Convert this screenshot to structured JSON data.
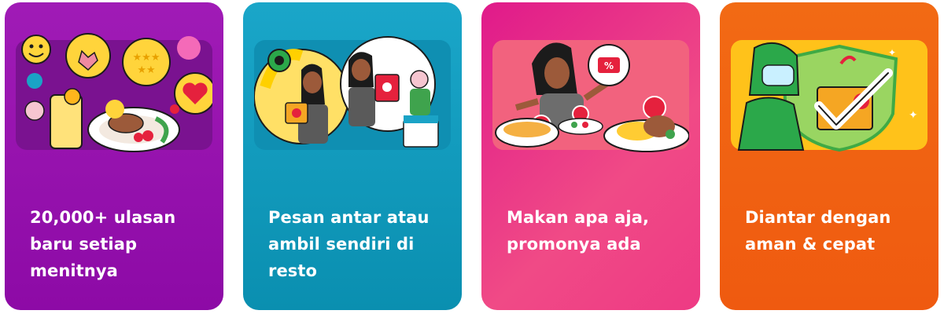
{
  "cards": [
    {
      "caption": "20,000+ ulasan\nbaru setiap\nmenitnya",
      "illustration": "reviews-illustration"
    },
    {
      "caption": "Pesan antar atau\nambil sendiri di\nresto",
      "illustration": "pickup-delivery-illustration"
    },
    {
      "caption": "Makan apa aja,\npromonya ada",
      "illustration": "promo-food-illustration"
    },
    {
      "caption": "Diantar dengan\naman & cepat",
      "illustration": "safe-delivery-illustration"
    }
  ],
  "colors": {
    "card1": "#9b17b2",
    "card2": "#1aa3c6",
    "card3": "#e6207f",
    "card4": "#f1620f"
  }
}
